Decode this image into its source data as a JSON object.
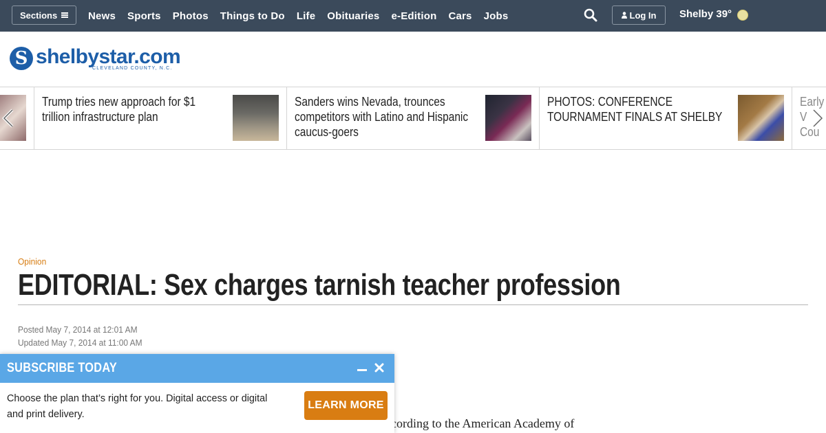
{
  "topbar": {
    "sections_label": "Sections",
    "nav_items": [
      "News",
      "Sports",
      "Photos",
      "Things to Do",
      "Life",
      "Obituaries",
      "e-Edition",
      "Cars",
      "Jobs"
    ],
    "login_label": "Log In",
    "weather": "Shelby 39°"
  },
  "logo": {
    "name": "shelbystar.com",
    "tagline": "CLEVELAND COUNTY, N.C."
  },
  "carousel": {
    "left_partial_title": "",
    "cards": [
      {
        "title": "Trump tries new approach for $1 trillion infrastructure plan"
      },
      {
        "title": "Sanders wins Nevada, trounces competitors with Latino and Hispanic caucus-goers"
      },
      {
        "title": "PHOTOS: CONFERENCE TOURNAMENT FINALS AT SHELBY"
      }
    ],
    "right_partial_title": "Early V Cou"
  },
  "article": {
    "section": "Opinion",
    "headline": "EDITORIAL: Sex charges tarnish teacher profession",
    "posted": "Posted May 7, 2014 at 12:01 AM",
    "updated": "Updated May 7, 2014 at 11:00 AM",
    "body_snippet": "ccording to the American Academy of"
  },
  "promo": {
    "title": "SUBSCRIBE TODAY",
    "text": "Choose the plan that’s right for you. Digital access or digital and print delivery.",
    "button_label": "LEARN MORE"
  },
  "colors": {
    "topbar_bg": "#3b4a5b",
    "brand_blue": "#1d5ea8",
    "accent_orange": "#d97d12",
    "promo_blue": "#5aa7e6"
  }
}
